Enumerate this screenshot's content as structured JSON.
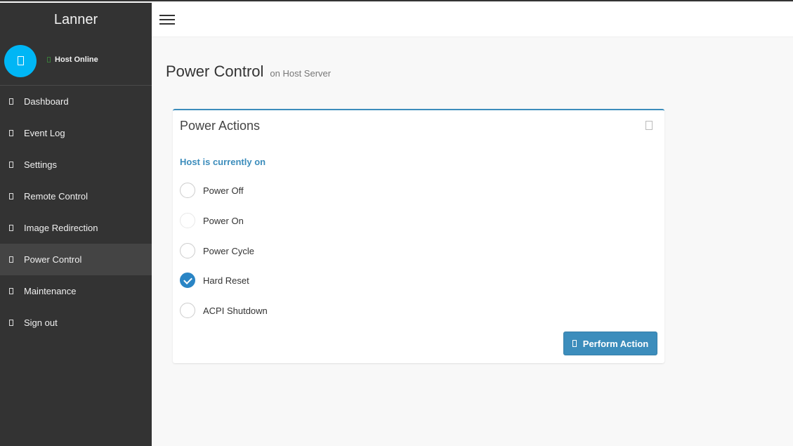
{
  "sidebar": {
    "brand": "Lanner",
    "status": "Host Online",
    "status_color": "#3a7a3a",
    "avatar_color": "#00b6f5",
    "items": [
      {
        "label": "Dashboard"
      },
      {
        "label": "Event Log"
      },
      {
        "label": "Settings"
      },
      {
        "label": "Remote Control"
      },
      {
        "label": "Image Redirection"
      },
      {
        "label": "Power Control",
        "active": true
      },
      {
        "label": "Maintenance"
      },
      {
        "label": "Sign out"
      }
    ]
  },
  "page": {
    "title": "Power Control",
    "subtitle": "on Host Server"
  },
  "box": {
    "title": "Power Actions",
    "host_state": "Host is currently on",
    "options": [
      {
        "label": "Power Off",
        "checked": false
      },
      {
        "label": "Power On",
        "checked": false
      },
      {
        "label": "Power Cycle",
        "checked": false
      },
      {
        "label": "Hard Reset",
        "checked": true
      },
      {
        "label": "ACPI Shutdown",
        "checked": false
      }
    ],
    "button": "Perform Action"
  },
  "colors": {
    "accent": "#3c8dbc",
    "sidebar": "#333333"
  }
}
